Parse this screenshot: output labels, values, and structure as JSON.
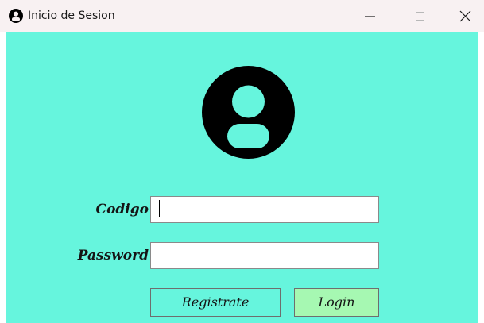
{
  "window": {
    "title": "Inicio de Sesion",
    "icon": "user-circle-icon",
    "controls": [
      "minimize-icon",
      "maximize-icon",
      "close-icon"
    ]
  },
  "form": {
    "avatar_icon": "user-circle-icon",
    "codigo_label": "Codigo",
    "codigo_value": "",
    "password_label": "Password",
    "password_value": "",
    "register_button": "Registrate",
    "login_button": "Login"
  },
  "colors": {
    "background": "#66f5dd",
    "titlebar": "#f8f1f2",
    "login_button": "#a6f8b2",
    "register_button": "#66f5dd"
  }
}
